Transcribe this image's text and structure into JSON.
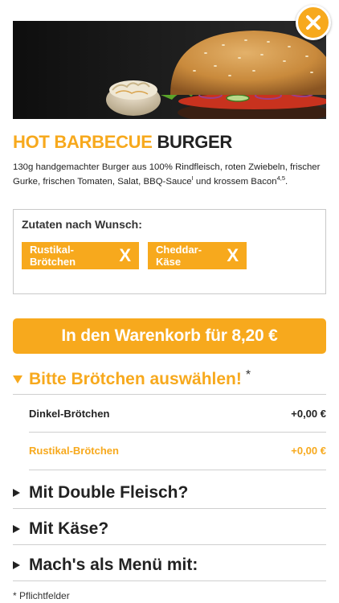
{
  "product": {
    "title_highlight": "HOT BARBECUE",
    "title_rest": "BURGER",
    "description_main": "130g handgemachter Burger aus 100% Rindfleisch, roten Zwiebeln, frischer Gurke, frischen Tomaten, Salat, BBQ-Sauce",
    "description_sup1": "I",
    "description_mid": " und krossem Bacon",
    "description_sup2": "4,5",
    "description_end": "."
  },
  "options": {
    "label": "Zutaten nach Wunsch:",
    "tags": [
      {
        "label": "Rustikal-Brötchen",
        "remove": "X"
      },
      {
        "label": "Cheddar-Käse",
        "remove": "X"
      }
    ]
  },
  "cart_button": {
    "label": "In den Warenkorb für 8,20 €"
  },
  "bun_section": {
    "title": "Bitte Brötchen auswählen!",
    "required_marker": "*",
    "items": [
      {
        "name": "Dinkel-Brötchen",
        "price": "+0,00 €",
        "selected": false
      },
      {
        "name": "Rustikal-Brötchen",
        "price": "+0,00 €",
        "selected": true
      }
    ]
  },
  "collapsed_sections": [
    {
      "title": "Mit Double Fleisch?"
    },
    {
      "title": "Mit Käse?"
    },
    {
      "title": "Mach's als Menü mit:"
    }
  ],
  "footnote": "* Pflichtfelder",
  "colors": {
    "accent": "#f7a91d",
    "text": "#222222",
    "divider": "#cfcfcf"
  },
  "icons": {
    "close": "close-icon",
    "expanded": "triangle-down-icon",
    "collapsed": "triangle-right-icon"
  }
}
